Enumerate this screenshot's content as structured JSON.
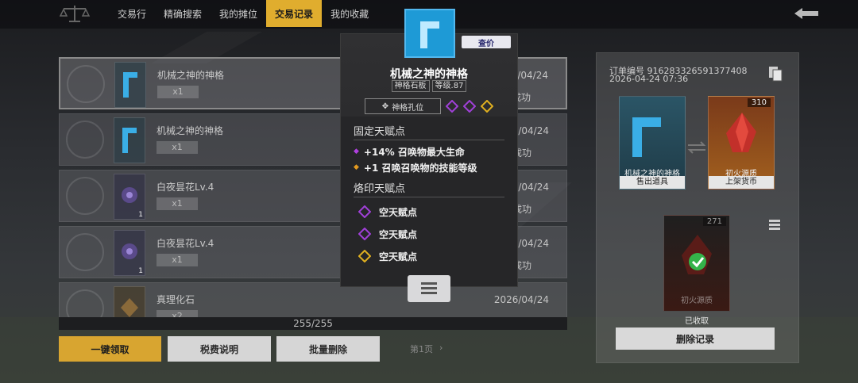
{
  "nav": {
    "tabs": [
      {
        "label": "交易行"
      },
      {
        "label": "精确搜索"
      },
      {
        "label": "我的摊位"
      },
      {
        "label": "交易记录"
      },
      {
        "label": "我的收藏"
      }
    ],
    "active_tab": "交易记录"
  },
  "records": [
    {
      "name": "机械之神的神格",
      "qty": "x1",
      "date": "2026/04/24",
      "status": "成功",
      "thumb": "blue-glyph"
    },
    {
      "name": "机械之神的神格",
      "qty": "x1",
      "date": "2026/04/24",
      "status": "成功",
      "thumb": "blue-glyph"
    },
    {
      "name": "白夜昙花Lv.4",
      "qty": "x1",
      "date": "2026/04/24",
      "status": "成功",
      "thumb_count": "1",
      "thumb": "purple-flower"
    },
    {
      "name": "白夜昙花Lv.4",
      "qty": "x1",
      "date": "2026/04/24",
      "status": "成功",
      "thumb_count": "1",
      "thumb": "purple-flower"
    },
    {
      "name": "真理化石",
      "qty": "x2",
      "date": "2026/04/24",
      "status": "",
      "thumb": "gold-stone"
    }
  ],
  "list_count": "255/255",
  "buttons": {
    "claim_all": "一键领取",
    "tax_info": "税费说明",
    "batch_delete": "批量删除"
  },
  "pagination": {
    "page_label": "第1页"
  },
  "popup": {
    "title": "机械之神的神格",
    "tag_type": "神格石板",
    "tag_level": "等级.87",
    "price_button": "查价",
    "slot_label": "神格孔位",
    "fixed_section": "固定天赋点",
    "fixed_attrs": [
      {
        "text": "+14% 召唤物最大生命",
        "color": "#b040e0"
      },
      {
        "text": "+1 召唤召唤物的技能等级",
        "color": "#e29a20"
      }
    ],
    "imprint_section": "烙印天赋点",
    "imprint_slots": [
      {
        "text": "空天赋点",
        "color": "#a040d8"
      },
      {
        "text": "空天赋点",
        "color": "#a040d8"
      },
      {
        "text": "空天赋点",
        "color": "#e0b020"
      }
    ]
  },
  "order": {
    "number": "订单编号 916283326591377408",
    "time": "2026-04-24 07:36",
    "sold_item_name": "机械之神的神格",
    "sold_caption": "售出道具",
    "currency_name": "初火源质",
    "currency_caption": "上架货币",
    "currency_amount": "310",
    "received_name": "初火源质",
    "received_amount": "271",
    "received_caption": "已收取",
    "delete_button": "删除记录"
  },
  "colors": {
    "accent_gold": "#e0ad2e",
    "item_blue": "#1e9ad6",
    "check_green": "#34b34a"
  }
}
